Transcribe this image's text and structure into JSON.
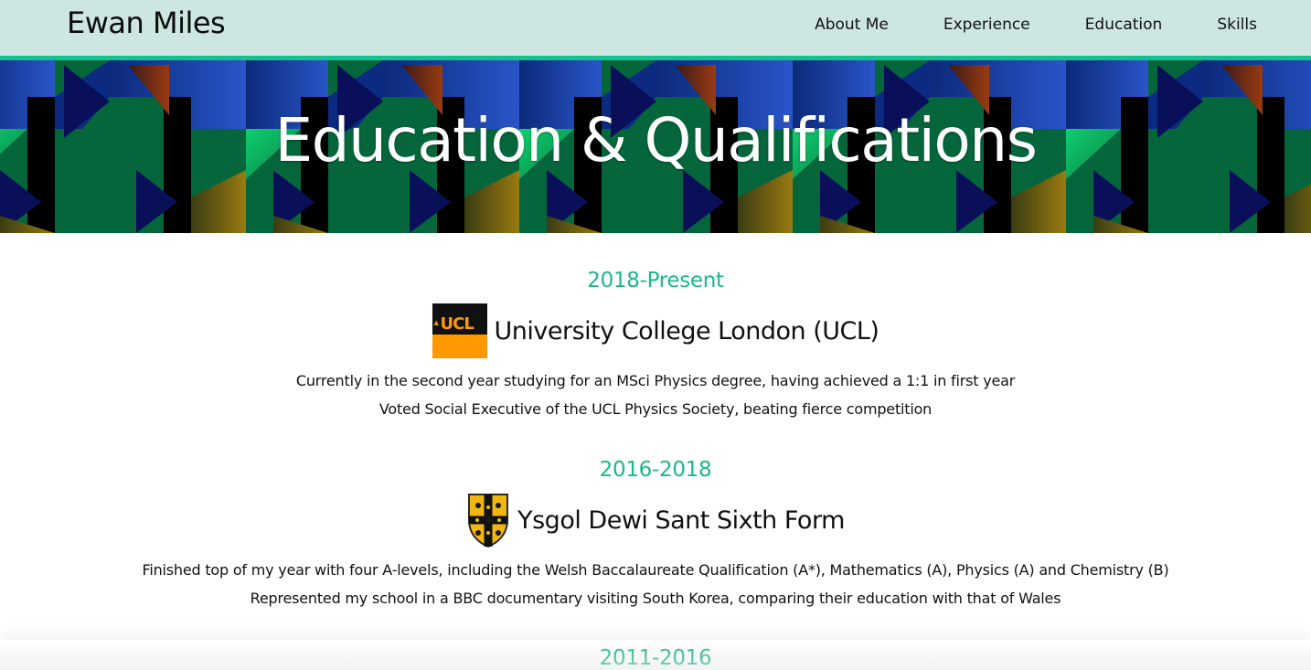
{
  "header": {
    "brand": "Ewan Miles",
    "nav": [
      {
        "label": "About Me"
      },
      {
        "label": "Experience"
      },
      {
        "label": "Education"
      },
      {
        "label": "Skills"
      }
    ]
  },
  "hero": {
    "title": "Education & Qualifications"
  },
  "education": [
    {
      "period": "2018-Present",
      "institution": "University College London (UCL)",
      "logo_text": "UCL",
      "details": [
        "Currently in the second year studying for an MSci Physics degree, having achieved a 1:1 in first year",
        "Voted Social Executive of the UCL Physics Society, beating fierce competition"
      ]
    },
    {
      "period": "2016-2018",
      "institution": "Ysgol Dewi Sant Sixth Form",
      "details": [
        "Finished top of my year with four A-levels, including the Welsh Baccalaureate Qualification (A*), Mathematics (A), Physics (A) and Chemistry (B)",
        "Represented my school in a BBC documentary visiting South Korea, comparing their education with that of Wales"
      ]
    },
    {
      "period": "2011-2016"
    }
  ],
  "colors": {
    "nav_bg": "#cde6e1",
    "accent": "#16c08f",
    "period_text": "#1ab98a",
    "ucl_orange": "#ff9900"
  }
}
